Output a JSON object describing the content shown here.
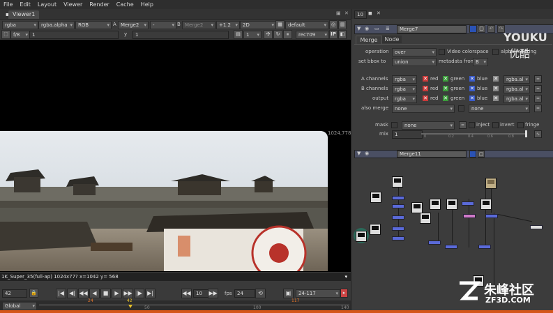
{
  "menu": [
    "File",
    "Edit",
    "Layout",
    "Viewer",
    "Render",
    "Cache",
    "Help"
  ],
  "viewer": {
    "tab": "Viewer1",
    "toolbar1": {
      "channels": "rgba",
      "layer": "rgba.alpha",
      "display": "RGB",
      "a_label": "A",
      "a_input": "Merge2",
      "a_blend": "-",
      "b_label": "B",
      "b_input": "Merge2",
      "gain": "+1.2",
      "view": "2D",
      "lut": "default"
    },
    "toolbar2": {
      "f_stop": "f/8",
      "f_value": "1",
      "y_label": "y",
      "y_value": "1",
      "proxy": "1",
      "colorspace": "rec709",
      "ip": "IP"
    },
    "format_right": "1024,778",
    "status": "1K_Super_35(full-ap) 1024x77?  x=1042 y= 568"
  },
  "transport": {
    "current_frame": "42",
    "increment": "10",
    "fps_label": "fps",
    "fps": "24",
    "range": "24-117",
    "buttons": [
      "|◀",
      "◀|",
      "◀◀",
      "◀",
      "■",
      "▶",
      "▶▶",
      "|▶",
      "▶|"
    ]
  },
  "timeline": {
    "mode": "Global",
    "markers": [
      "24",
      "42",
      "50",
      "100",
      "117",
      "140"
    ]
  },
  "props": {
    "tab_number": "10",
    "panel_title": "Merge7",
    "tabs": [
      "Merge",
      "Node"
    ],
    "operation_label": "operation",
    "operation": "over",
    "video_colorspace": "Video colorspace",
    "alpha_masking": "alpha masking",
    "set_bbox_label": "set bbox to",
    "set_bbox": "union",
    "metadata_label": "metadata from",
    "metadata": "B",
    "a_channels_label": "A channels",
    "a_channels": "rgba",
    "b_channels_label": "B channels",
    "b_channels": "rgba",
    "output_label": "output",
    "output": "rgba",
    "red": "red",
    "green": "green",
    "blue": "blue",
    "alpha_sel": "rgba.al",
    "also_merge_label": "also merge",
    "also_merge": "none",
    "also_merge2": "none",
    "mask_label": "mask",
    "mask": "none",
    "inject": "inject",
    "invert": "invert",
    "fringe": "fringe",
    "mix_label": "mix",
    "mix": "1",
    "mix_ticks": [
      "0",
      "0.1",
      "0.2",
      "0.3",
      "0.4",
      "0.5",
      "0.6",
      "0.7",
      "0.8"
    ]
  },
  "props2": {
    "panel_title": "Merge11"
  },
  "watermark": {
    "youku": "YOUKU",
    "youku_cn": "优酷",
    "site_cn": "朱峰社区",
    "site": "ZF3D.COM"
  }
}
